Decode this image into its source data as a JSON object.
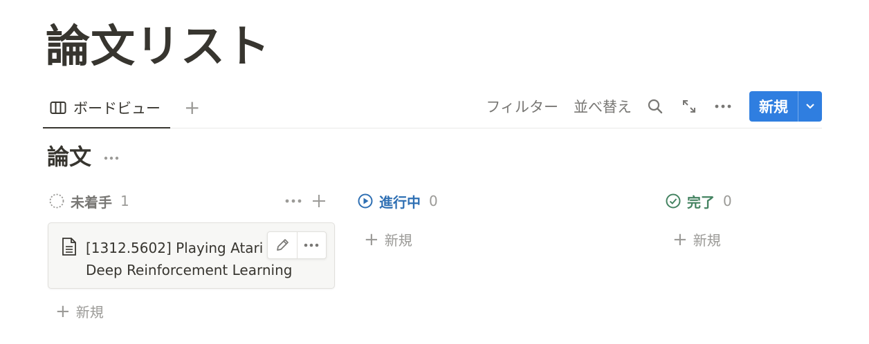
{
  "page": {
    "title": "論文リスト"
  },
  "view_bar": {
    "active_tab": "ボードビュー",
    "filter_label": "フィルター",
    "sort_label": "並べ替え",
    "new_label": "新規"
  },
  "database": {
    "title": "論文"
  },
  "groups": [
    {
      "name": "未着手",
      "count": "1",
      "color": "#787774",
      "add_label": "新規"
    },
    {
      "name": "進行中",
      "count": "0",
      "color": "#2e6fb3",
      "add_label": "新規"
    },
    {
      "name": "完了",
      "count": "0",
      "color": "#448361",
      "add_label": "新規"
    }
  ],
  "cards": [
    {
      "title": "[1312.5602] Playing Atari with Deep Reinforcement Learning"
    }
  ],
  "icons": {
    "tab": "board-icon",
    "search": "search-icon",
    "expand": "expand-icon",
    "more": "more-icon",
    "dropdown": "chevron-down-icon"
  },
  "colors": {
    "accent": "#2f7ee0",
    "text": "#37352f",
    "muted": "#9b9a97"
  }
}
